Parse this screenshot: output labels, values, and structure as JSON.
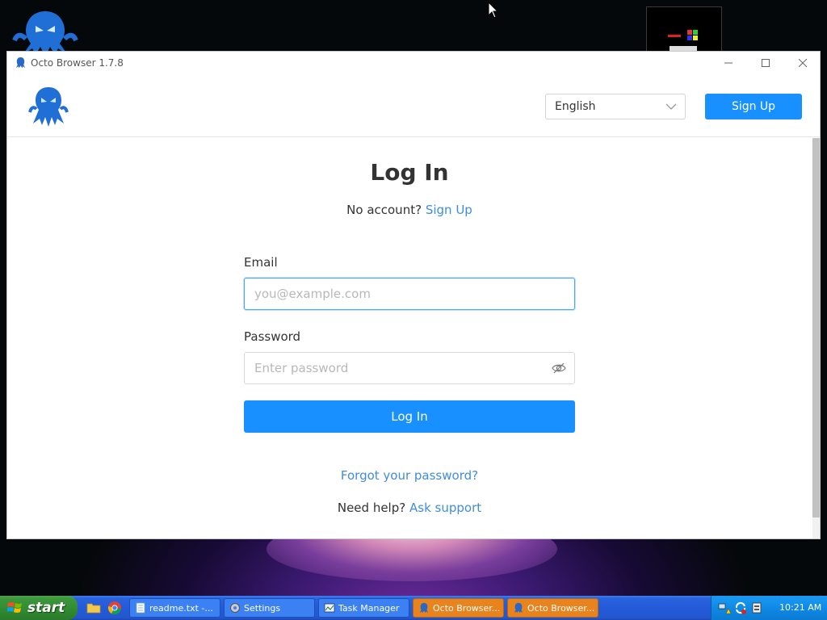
{
  "window": {
    "title": "Octo Browser 1.7.8"
  },
  "header": {
    "language": "English",
    "signup_label": "Sign Up"
  },
  "login": {
    "title": "Log In",
    "no_account_text": "No account?",
    "no_account_link": "Sign Up",
    "email_label": "Email",
    "email_placeholder": "you@example.com",
    "email_value": "",
    "password_label": "Password",
    "password_placeholder": "Enter password",
    "password_value": "",
    "login_button": "Log In",
    "forgot_link": "Forgot your password?",
    "help_text": "Need help?",
    "help_link": "Ask support"
  },
  "taskbar": {
    "start_label": "start",
    "tasks": [
      {
        "label": "readme.txt -...",
        "icon": "notepad-icon"
      },
      {
        "label": "Settings",
        "icon": "gear-icon"
      },
      {
        "label": "Task Manager",
        "icon": "task-manager-icon"
      },
      {
        "label": "Octo Browser...",
        "icon": "octo-icon"
      },
      {
        "label": "Octo Browser...",
        "icon": "octo-icon"
      }
    ],
    "clock": "10:21 AM"
  },
  "colors": {
    "accent": "#1890ff",
    "link": "#3f8ddc",
    "taskbar": "#245ad8",
    "start": "#318a31",
    "active_task": "#e8831e"
  }
}
